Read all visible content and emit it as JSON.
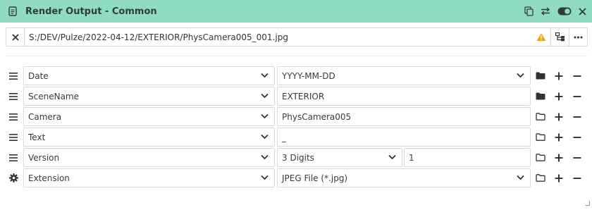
{
  "window": {
    "title": "Render Output - Common",
    "icons": [
      "document-icon",
      "copy-icon",
      "swap-icon",
      "toggle-icon",
      "close-icon"
    ]
  },
  "output": {
    "path": "S:/DEV/Pulze/2022-04-12/EXTERIOR/PhysCamera005_001.jpg",
    "warning_icon": "warning-icon",
    "tree_icon": "tree-icon",
    "more_icon": "more-icon",
    "warning_color": "#f0a30a"
  },
  "rows": [
    {
      "key": "Date",
      "value": "YYYY-MM-DD",
      "value_dropdown": true,
      "handle": "drag-handle-icon",
      "folder": "folder-filled-icon"
    },
    {
      "key": "SceneName",
      "value": "EXTERIOR",
      "value_dropdown": false,
      "handle": "drag-handle-icon",
      "folder": "folder-filled-icon"
    },
    {
      "key": "Camera",
      "value": "PhysCamera005",
      "value_dropdown": false,
      "handle": "drag-handle-icon",
      "folder": "folder-outline-icon"
    },
    {
      "key": "Text",
      "value": "_",
      "value_dropdown": false,
      "handle": "drag-handle-icon",
      "folder": "folder-outline-icon"
    },
    {
      "key": "Version",
      "value": "3 Digits",
      "value_dropdown": true,
      "extra": "1",
      "handle": "drag-handle-icon",
      "folder": "folder-outline-icon"
    },
    {
      "key": "Extension",
      "value": "JPEG File (*.jpg)",
      "value_dropdown": true,
      "handle": "gear-icon",
      "folder": "folder-outline-icon"
    }
  ],
  "colors": {
    "titlebar": "#8fdcc1",
    "text": "#3a3a3a",
    "border": "#d9d9d9"
  }
}
